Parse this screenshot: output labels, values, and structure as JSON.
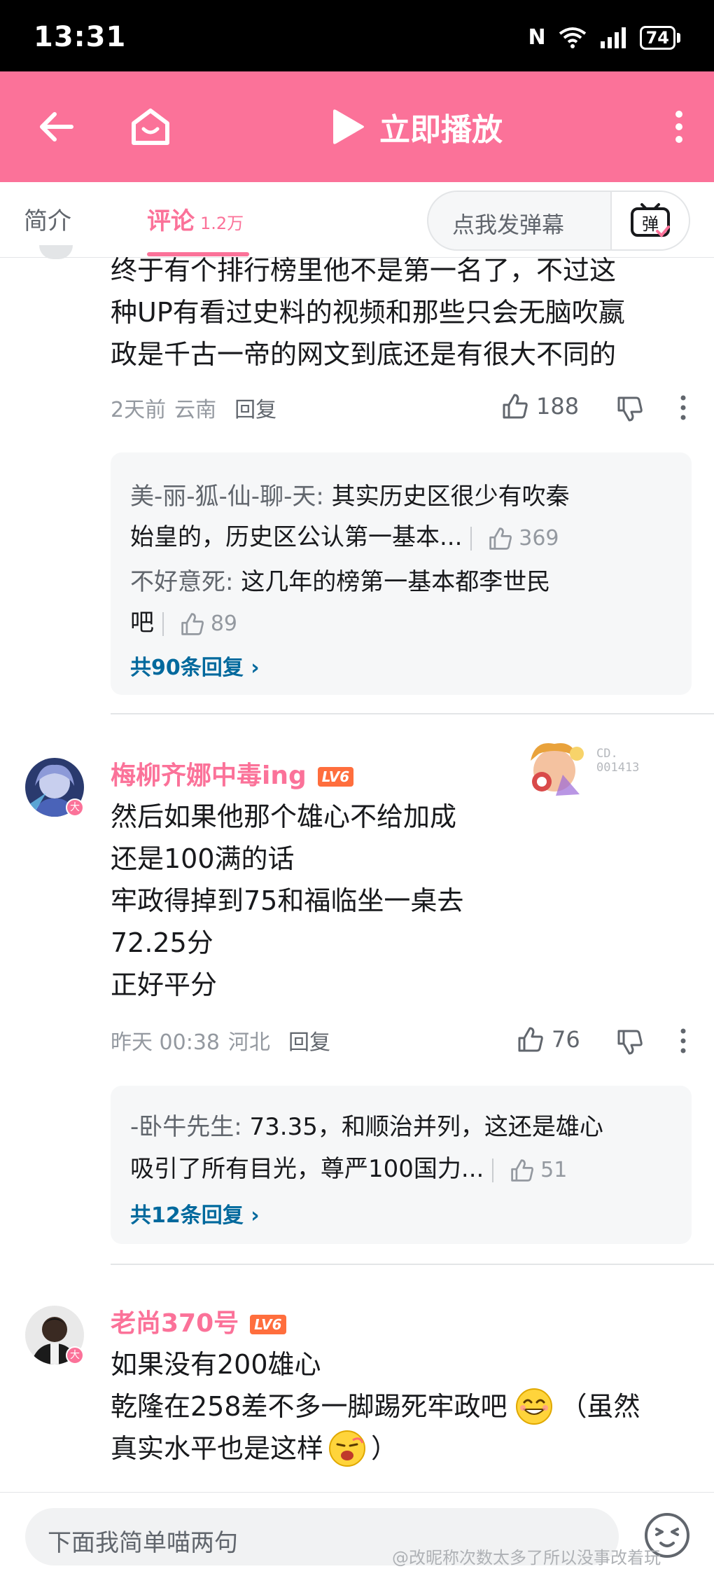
{
  "status_bar": {
    "time": "13:31",
    "battery": "74",
    "nfc": "N"
  },
  "header": {
    "play_label": "立即播放"
  },
  "tabs": {
    "intro_label": "简介",
    "comments_label": "评论",
    "comments_count": "1.2万"
  },
  "danmaku": {
    "placeholder": "点我发弹幕",
    "button_glyph": "弹"
  },
  "comment1": {
    "lines": [
      "终于有个排行榜里他不是第一名了，不过这",
      "种UP有看过史料的视频和那些只会无脑吹嬴",
      "政是千古一帝的网文到底还是有很大不同的"
    ],
    "time": "2天前",
    "location": "云南",
    "reply_label": "回复",
    "likes": "188",
    "replies": [
      {
        "author": "美-丽-狐-仙-聊-天:",
        "text_line1": " 其实历史区很少有吹秦",
        "text_line2": "始皇的，历史区公认第一基本...",
        "likes": "369"
      },
      {
        "author": "不好意死:",
        "text_line1": " 这几年的榜第一基本都李世民",
        "text_line2": "吧",
        "likes": "89"
      }
    ],
    "see_all": "共90条回复"
  },
  "comment2": {
    "username": "梅柳齐娜中毒ing",
    "level": "LV6",
    "badge_text": "CD.\n001413",
    "lines": [
      "然后如果他那个雄心不给加成",
      "还是100满的话",
      "牢政得掉到75和福临坐一桌去",
      "72.25分",
      "正好平分"
    ],
    "time": "昨天 00:38",
    "location": "河北",
    "reply_label": "回复",
    "likes": "76",
    "replies": [
      {
        "author": "-卧牛先生:",
        "text_line1": " 73.35，和顺治并列，这还是雄心",
        "text_line2": "吸引了所有目光，尊严100国力...",
        "likes": "51"
      }
    ],
    "see_all": "共12条回复"
  },
  "comment3": {
    "username": "老尚370号",
    "level": "LV6",
    "line1": "如果没有200雄心",
    "line2": "乾隆在258差不多一脚踢死牢政吧",
    "line2_tail": "（虽然",
    "line3": "真实水平也是这样",
    "line3_tail": "）"
  },
  "bottom": {
    "input_placeholder": "下面我简单喵两句",
    "watermark": "@改昵称次数太多了所以没事改着玩"
  },
  "avatar_badge": "大",
  "colors": {
    "brand_pink": "#fb7299",
    "link_blue": "#00699d",
    "text_gray": "#9499a0"
  }
}
